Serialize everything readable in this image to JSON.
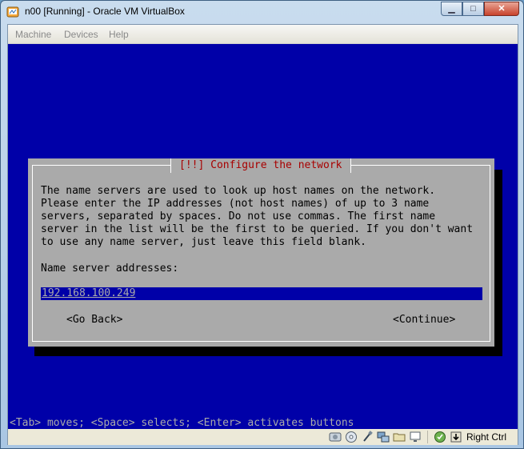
{
  "window": {
    "title": "n00 [Running] - Oracle VM VirtualBox",
    "buttons": {
      "minimize": "▁",
      "maximize": "□",
      "close": "✕"
    }
  },
  "menu": {
    "items": [
      "Machine",
      "Devices",
      "Help"
    ]
  },
  "dialog": {
    "title": "[!!] Configure the network",
    "text": "The name servers are used to look up host names on the network.\nPlease enter the IP addresses (not host names) of up to 3 name\nservers, separated by spaces. Do not use commas. The first name\nserver in the list will be the first to be queried. If you don't want\nto use any name server, just leave this field blank.",
    "label": "Name server addresses:",
    "field_value": "192.168.100.249",
    "back_button": "<Go Back>",
    "continue_button": "<Continue>"
  },
  "help_line": "<Tab> moves; <Space> selects; <Enter> activates buttons",
  "statusbar": {
    "icons": [
      "hard-disk-icon",
      "optical-drive-icon",
      "usb-icon",
      "network-icon",
      "shared-folders-icon",
      "display-icon",
      "virtualization-icon",
      "mouse-integration-icon"
    ],
    "host_key": "Right Ctrl"
  },
  "colors": {
    "console_bg": "#0000a8",
    "dialog_bg": "#aaaaaa",
    "dialog_title": "#a80000"
  }
}
